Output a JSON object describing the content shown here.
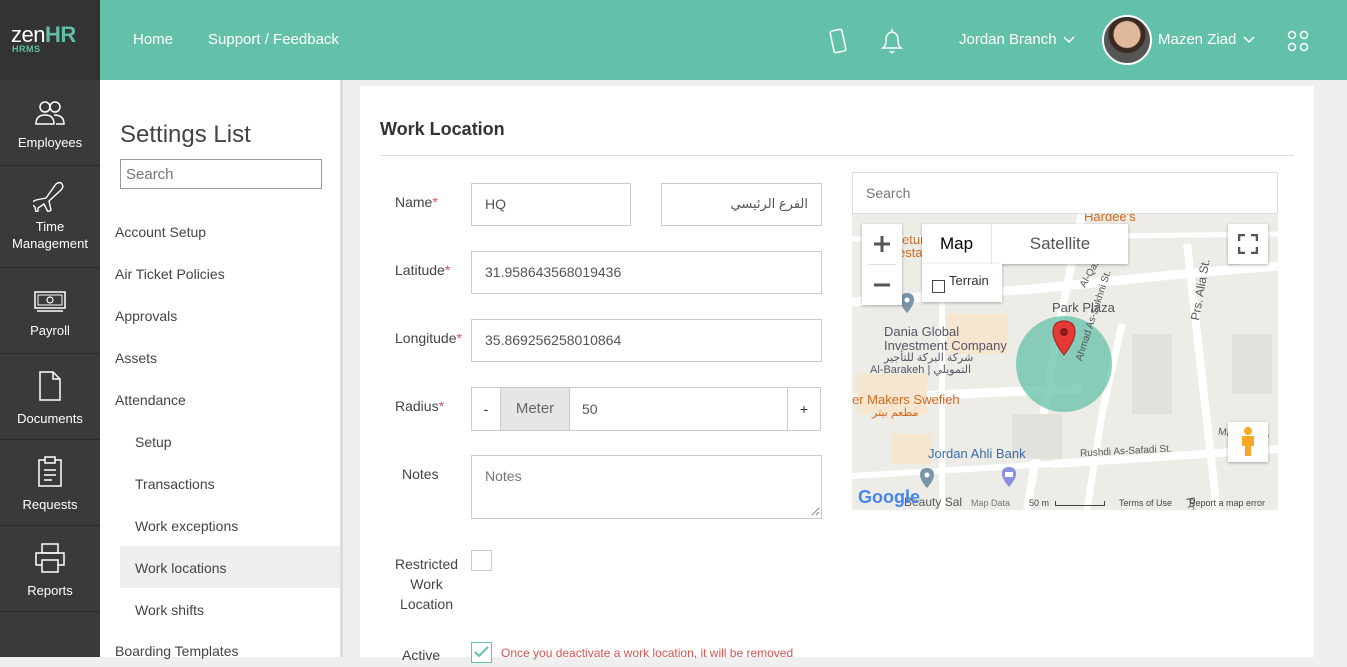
{
  "brand": {
    "name_light": "zen",
    "name_bold": "HR",
    "sub": "HRMS"
  },
  "leftnav": [
    {
      "label": "Employees"
    },
    {
      "label_line1": "Time",
      "label_line2": "Management"
    },
    {
      "label": "Payroll"
    },
    {
      "label": "Documents"
    },
    {
      "label": "Requests"
    },
    {
      "label": "Reports"
    }
  ],
  "topbar": {
    "home": "Home",
    "support": "Support / Feedback",
    "branch": "Jordan Branch",
    "user": "Mazen Ziad"
  },
  "settings": {
    "title": "Settings List",
    "search_placeholder": "Search",
    "items": [
      "Account Setup",
      "Air Ticket Policies",
      "Approvals",
      "Assets",
      "Attendance",
      "Setup",
      "Transactions",
      "Work exceptions",
      "Work locations",
      "Work shifts",
      "Boarding Templates"
    ]
  },
  "form": {
    "title": "Work Location",
    "name_label": "Name",
    "name_en": "HQ",
    "name_ar": "الفرع الرئيسي",
    "latitude_label": "Latitude",
    "latitude": "31.958643568019436",
    "longitude_label": "Longitude",
    "longitude": "35.869256258010864",
    "radius_label": "Radius",
    "radius_minus": "-",
    "radius_unit": "Meter",
    "radius_value": "50",
    "radius_plus": "+",
    "notes_label": "Notes",
    "notes_placeholder": "Notes",
    "restricted_line1": "Restricted",
    "restricted_line2": "Work",
    "restricted_line3": "Location",
    "active_label": "Active",
    "active_warning": "Once you deactivate a work location, it will be removed"
  },
  "map": {
    "search_placeholder": "Search",
    "tab_map": "Map",
    "tab_satellite": "Satellite",
    "terrain": "Terrain",
    "labels": {
      "park_plaza": "Park Plaza",
      "dania1": "Dania Global",
      "dania2": "Investment Company",
      "dania_ar": "شركة البركة للتأجير",
      "barakeh": "Al-Barakeh | التمويلي",
      "makers": "er Makers Swefieh",
      "makers_ar": "مطعم بيتر",
      "ahli": "Jordan Ahli Bank",
      "beauty": "Beauty Sal",
      "rushdi": "Rushdi As-Safadi St.",
      "sukhni": "Ahmad As-Sukhni St.",
      "alia1": "Prs. Alia St.",
      "alia2": "Prs. Ali",
      "mawlud": "Mawloud M",
      "qasabi": "Al-Qasabi St.",
      "hardees": "Hardee's",
      "retur": "etur",
      "restaurant": "estaurant &",
      "google": "Google",
      "map_data": "Map Data",
      "scale": "50 m",
      "terms": "Terms of Use",
      "report": "Report a map error"
    },
    "colors": {
      "circle": "#63c1aa",
      "pin": "#e53935"
    }
  }
}
